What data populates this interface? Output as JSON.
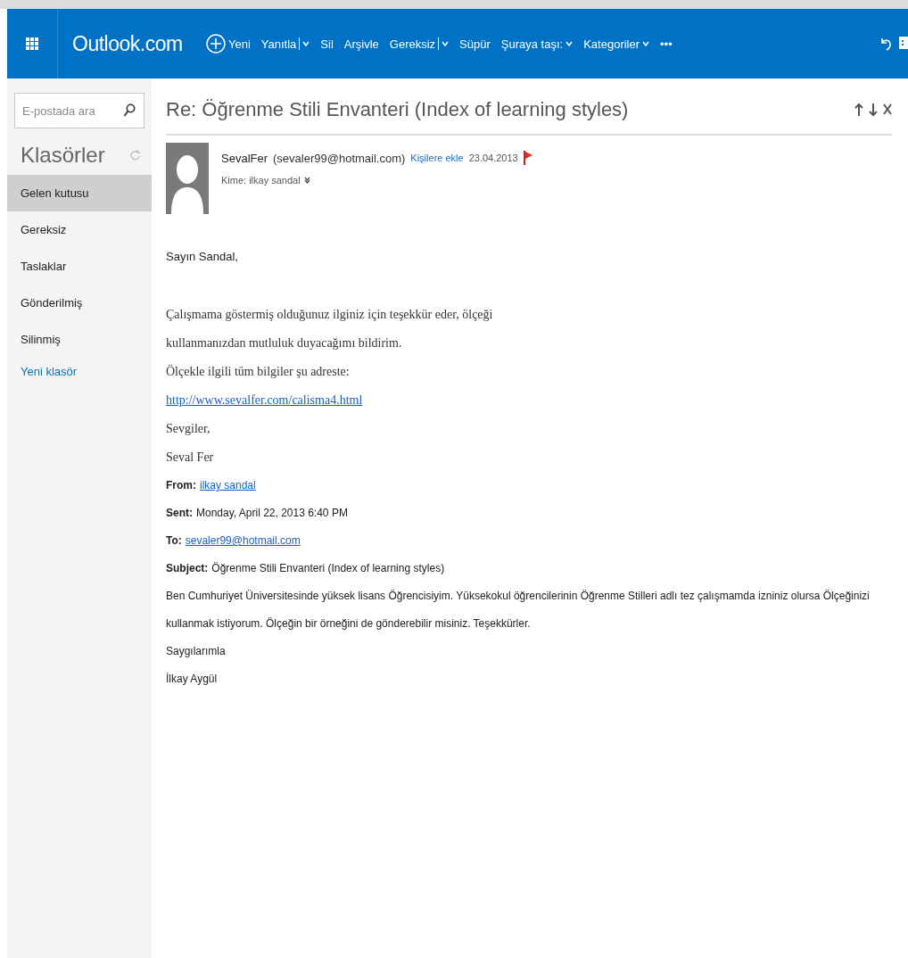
{
  "app": {
    "name": "Outlook.com"
  },
  "toolbar": [
    {
      "label": "Yeni",
      "kind": "new"
    },
    {
      "label": "Yanıtla",
      "kind": "split"
    },
    {
      "label": "Sil",
      "kind": "plain"
    },
    {
      "label": "Arşivle",
      "kind": "plain"
    },
    {
      "label": "Gereksiz",
      "kind": "split"
    },
    {
      "label": "Süpür",
      "kind": "plain"
    },
    {
      "label": "Şuraya taşı:",
      "kind": "menu"
    },
    {
      "label": "Kategoriler",
      "kind": "menu"
    },
    {
      "label": "•••",
      "kind": "plain"
    }
  ],
  "search": {
    "placeholder": "E-postada ara"
  },
  "sidebar": {
    "title": "Klasörler",
    "items": [
      {
        "label": "Gelen kutusu",
        "selected": true
      },
      {
        "label": "Gereksiz",
        "selected": false
      },
      {
        "label": "Taslaklar",
        "selected": false
      },
      {
        "label": "Gönderilmiş",
        "selected": false
      },
      {
        "label": "Silinmiş",
        "selected": false
      }
    ],
    "new_folder": "Yeni klasör"
  },
  "message": {
    "subject": "Re: Öğrenme Stili Envanteri (Index of learning styles)",
    "sender_name": "SevalFer",
    "sender_email": "(sevaler99@hotmail.com)",
    "add_contact": "Kişilere ekle",
    "date": "23.04.2013",
    "flagged": true,
    "to": "Kime: ilkay sandal",
    "greeting": "Sayın Sandal,",
    "reply_lines": [
      {
        "text": "Çalışmama göstermiş olduğunuz ilginiz için teşekkür eder, ölçeği",
        "kind": "text"
      },
      {
        "text": "kullanmanızdan mutluluk duyacağımı bildirim.",
        "kind": "text"
      },
      {
        "text": "Ölçekle ilgili tüm bilgiler şu adreste:",
        "kind": "text"
      },
      {
        "text": "http://www.sevalfer.com/calisma4.html",
        "kind": "link"
      },
      {
        "text": "Sevgiler,",
        "kind": "text"
      },
      {
        "text": "Seval Fer",
        "kind": "text"
      }
    ],
    "quoted_header": [
      {
        "label": "From:",
        "value": "ilkay sandal",
        "kind": "link"
      },
      {
        "label": "Sent:",
        "value": "Monday, April 22, 2013 6:40 PM",
        "kind": "text"
      },
      {
        "label": "To:",
        "value": "sevaler99@hotmail.com",
        "kind": "link"
      },
      {
        "label": "Subject:",
        "value": "Öğrenme Stili Envanteri (Index of learning styles)",
        "kind": "text"
      }
    ],
    "quoted_body": [
      "Ben Cumhuriyet Üniversitesinde yüksek lisans Öğrencisiyim. Yüksekokul öğrencilerinin Öğrenme Stilleri adlı tez çalışmamda izniniz olursa Ölçeğinizi kullanmak istiyorum. Ölçeğin bir örneğini de gönderebilir misiniz. Teşekkürler.",
      "Saygılarımla",
      "İlkay Aygül"
    ]
  }
}
